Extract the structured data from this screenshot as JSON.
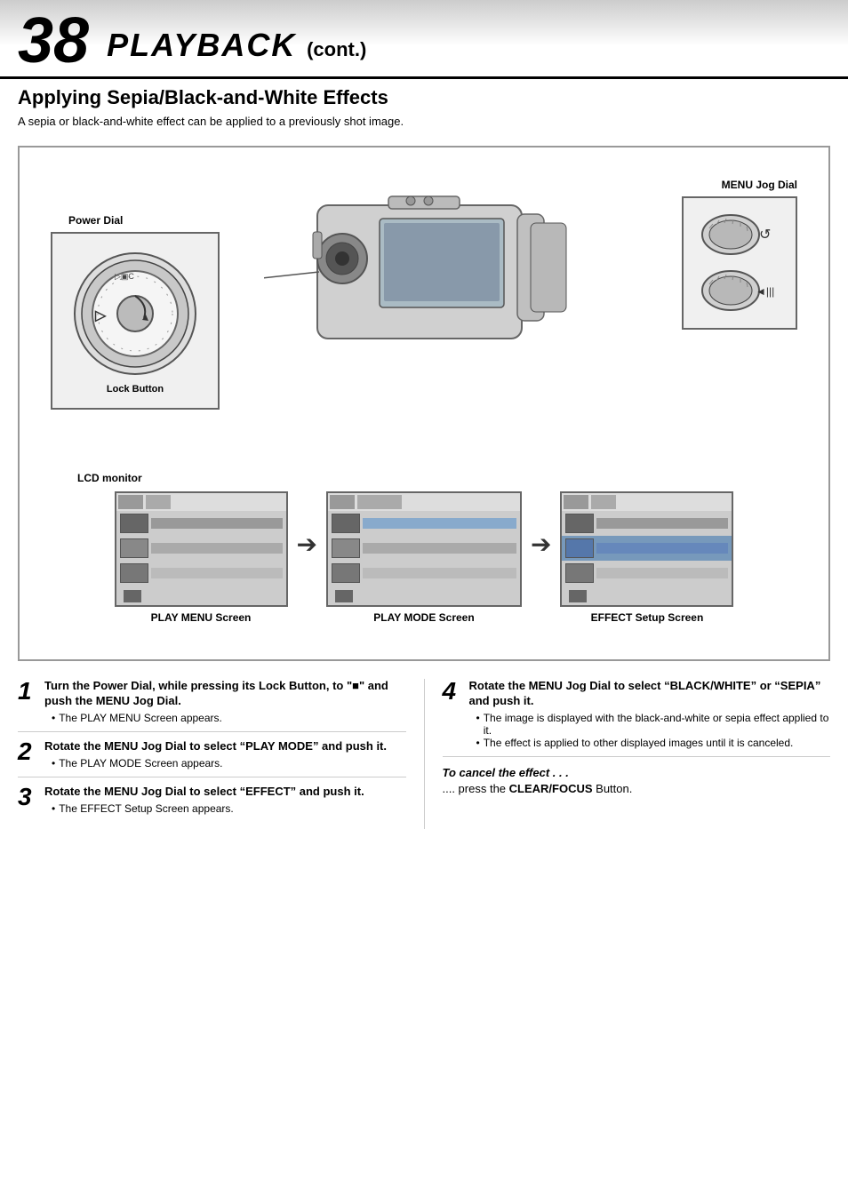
{
  "header": {
    "page_number": "38",
    "title": "PLAYBACK",
    "cont": "(cont.)"
  },
  "subtitle": "Applying Sepia/Black-and-White Effects",
  "description": "A sepia or black-and-white effect can be applied to a previously shot image.",
  "diagram": {
    "power_dial_label": "Power Dial",
    "lock_button_label": "Lock Button",
    "menu_jog_label": "MENU Jog Dial",
    "lcd_monitor_label": "LCD monitor",
    "screens": [
      {
        "label": "PLAY MENU Screen"
      },
      {
        "label": "PLAY MODE Screen"
      },
      {
        "label": "EFFECT Setup Screen"
      }
    ]
  },
  "steps": [
    {
      "number": "1",
      "title": "Turn the Power Dial, while pressing its Lock Button, to \"■\" and push the MENU Jog Dial.",
      "bullets": [
        "The PLAY MENU Screen appears."
      ]
    },
    {
      "number": "2",
      "title": "Rotate the MENU Jog Dial to select “PLAY MODE” and push it.",
      "bullets": [
        "The PLAY MODE Screen appears."
      ]
    },
    {
      "number": "3",
      "title": "Rotate the MENU Jog Dial to select “EFFECT” and push it.",
      "bullets": [
        "The EFFECT Setup Screen appears."
      ]
    }
  ],
  "steps_right": [
    {
      "number": "4",
      "title": "Rotate the MENU Jog Dial to select “BLACK/WHITE” or “SEPIA” and push it.",
      "bullets": [
        "The image is displayed with the black-and-white or sepia effect applied to it.",
        "The effect is applied to other displayed images until it is canceled."
      ]
    }
  ],
  "cancel": {
    "title": "To cancel the effect . . .",
    "body_prefix": ".... press the ",
    "button_name": "CLEAR/FOCUS",
    "body_suffix": " Button."
  }
}
